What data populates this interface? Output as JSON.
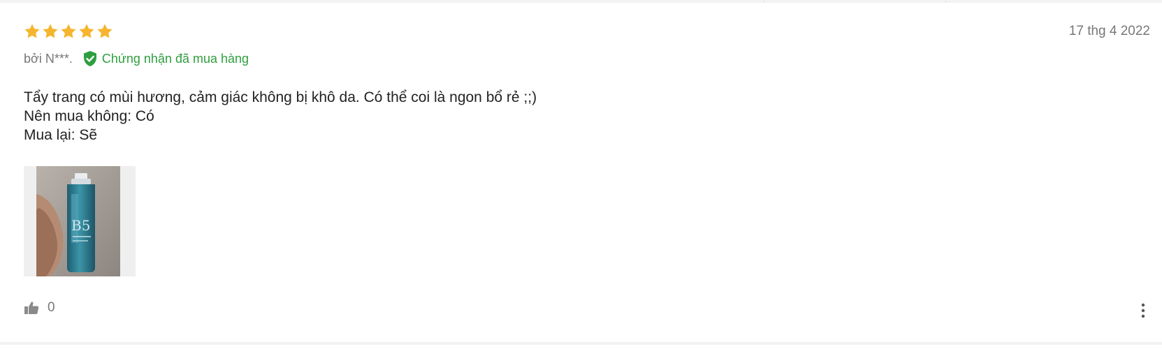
{
  "review": {
    "rating": 5,
    "rating_max": 5,
    "date": "17 thg 4 2022",
    "author": "bởi N***.",
    "verified_label": "Chứng nhận đã mua hàng",
    "body_lines": [
      "Tẩy trang có mùi hương, cảm giác không bị khô da. Có thể coi là ngon bổ rẻ ;;)",
      "Nên mua không: Có",
      "Mua lại: Sẽ"
    ],
    "photo_label": "B5",
    "helpful_count": "0"
  },
  "colors": {
    "star": "#f5b52e",
    "verified": "#2f9e3f",
    "muted_text": "#777777",
    "body_text": "#222222"
  },
  "icons": {
    "rating": "star-icon",
    "verified": "shield-check-icon",
    "helpful": "thumbs-up-icon",
    "menu": "more-vertical-icon"
  }
}
